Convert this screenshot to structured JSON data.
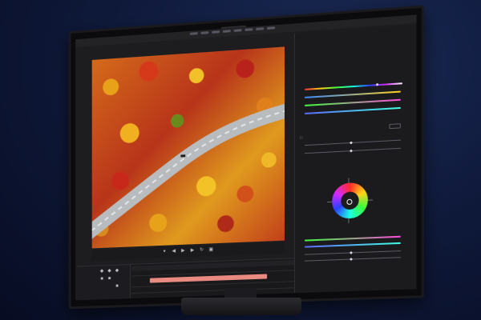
{
  "window": {
    "title": ""
  },
  "program_monitor": {
    "timecode_current": "",
    "timecode_duration": "",
    "image_subject": "autumn forest road aerial"
  },
  "controls": {
    "icons": [
      "marker-icon",
      "step-back-icon",
      "play-icon",
      "step-forward-icon",
      "loop-icon",
      "export-frame-icon"
    ]
  },
  "timeline": {
    "clip_label": ""
  },
  "lumetri_panel": {
    "title": "",
    "subtitle": "",
    "wheel_accent": "#ffffff"
  },
  "colors": {
    "background": "#0f1a3c",
    "accent_blue": "#4a9aff",
    "clip_pink": "#e88a80"
  },
  "watermark": {
    "text": ""
  }
}
